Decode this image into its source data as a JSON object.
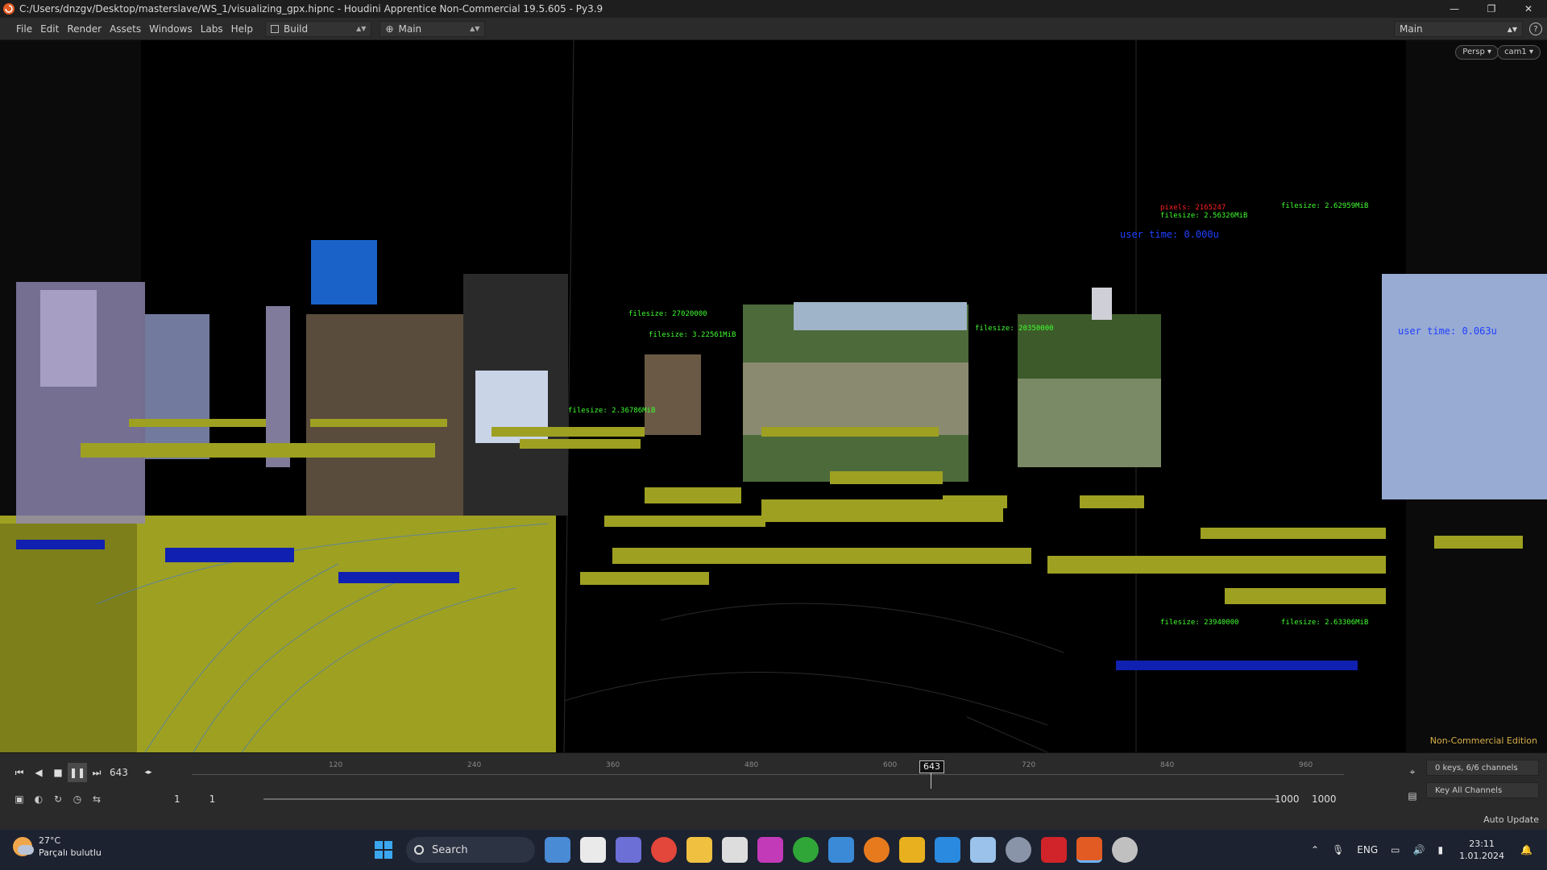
{
  "window": {
    "title": "C:/Users/dnzgv/Desktop/masterslave/WS_1/visualizing_gpx.hipnc - Houdini Apprentice Non-Commercial 19.5.605 - Py3.9",
    "minimize": "—",
    "maximize": "❐",
    "close": "✕"
  },
  "menubar": {
    "items": [
      "File",
      "Edit",
      "Render",
      "Assets",
      "Windows",
      "Labs",
      "Help"
    ],
    "desktop": "Build",
    "pane": "Main",
    "right_pane": "Main",
    "help": "?"
  },
  "viewport": {
    "persp": "Persp ▾",
    "cam": "cam1 ▾",
    "edition": "Non-Commercial Edition",
    "overlay_labels": [
      "pixels: 2165247",
      "filesize: 2.56326MiB",
      "filesize: 2.62959MiB",
      "user time: 0.000u",
      "filesize: 27020000",
      "filesize: 3.22561MiB",
      "filesize: 20350000",
      "filesize: 2.36786MiB",
      "user time: 0.063u",
      "filesize: 23940000",
      "filesize: 2.63306MiB"
    ]
  },
  "timeline": {
    "current_frame": "643",
    "ruler_ticks": [
      "120",
      "240",
      "360",
      "480",
      "600",
      "720",
      "840",
      "960"
    ],
    "range_start_a": "1",
    "range_start_b": "1",
    "range_end_a": "1000",
    "range_end_b": "1000",
    "keys_channels": "0 keys, 6/6 channels",
    "key_all_channels": "Key All Channels",
    "auto_update": "Auto Update"
  },
  "taskbar": {
    "weather_temp": "27°C",
    "weather_desc": "Parçalı bulutlu",
    "search": "Search",
    "lang": "ENG",
    "time": "23:11",
    "date": "1.01.2024"
  },
  "colors": {
    "olive": "#9ea022",
    "red_text": "#ff2020",
    "green_text": "#40ff30",
    "blue_text": "#2040ff",
    "accent_orange": "#e25b22"
  }
}
